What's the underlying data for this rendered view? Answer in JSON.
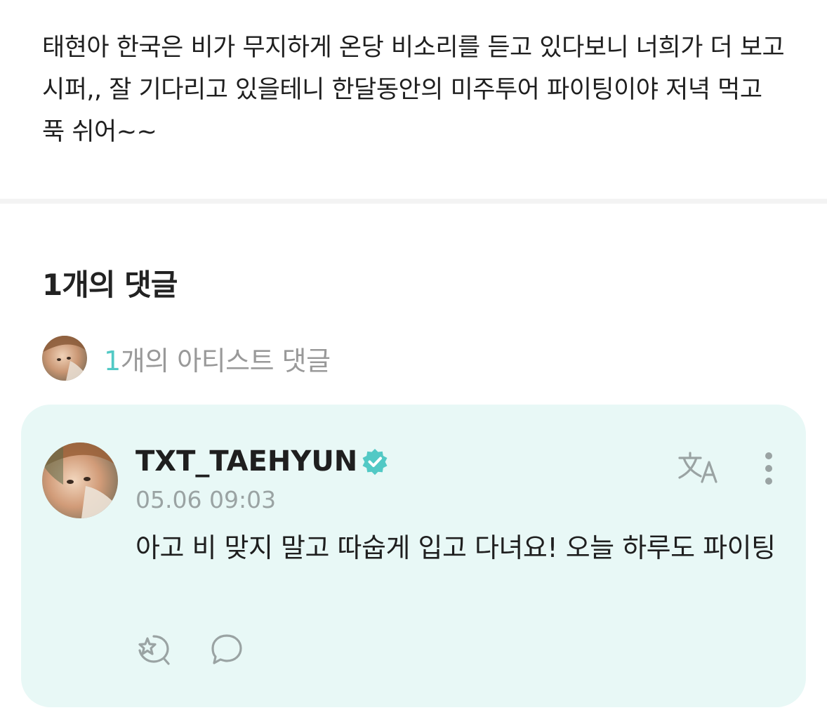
{
  "post": {
    "body": "태현아 한국은 비가 무지하게 온당 비소리를 듣고 있다보니 너희가 더 보고시퍼,, 잘 기다리고 있을테니 한달동안의 미주투어 파이팅이야 저녁 먹고 푹 쉬어~~"
  },
  "comments": {
    "heading": "1개의 댓글",
    "artist_count_number": "1",
    "artist_count_label": "개의 아티스트 댓글",
    "items": [
      {
        "username": "TXT_TAEHYUN",
        "verified": true,
        "timestamp": "05.06 09:03",
        "text": " 아고 비 맞지 말고 따숩게 입고 다녀요! 오늘 하루도 파이팅",
        "icons": {
          "translate": "translate-icon",
          "more": "more-vertical-icon",
          "like": "like-icon",
          "reply": "reply-bubble-icon"
        }
      }
    ]
  },
  "colors": {
    "accent": "#52c9c5",
    "card_background": "#e8f8f6",
    "muted_text": "#999999",
    "icon_gray": "#9aa3a3"
  }
}
